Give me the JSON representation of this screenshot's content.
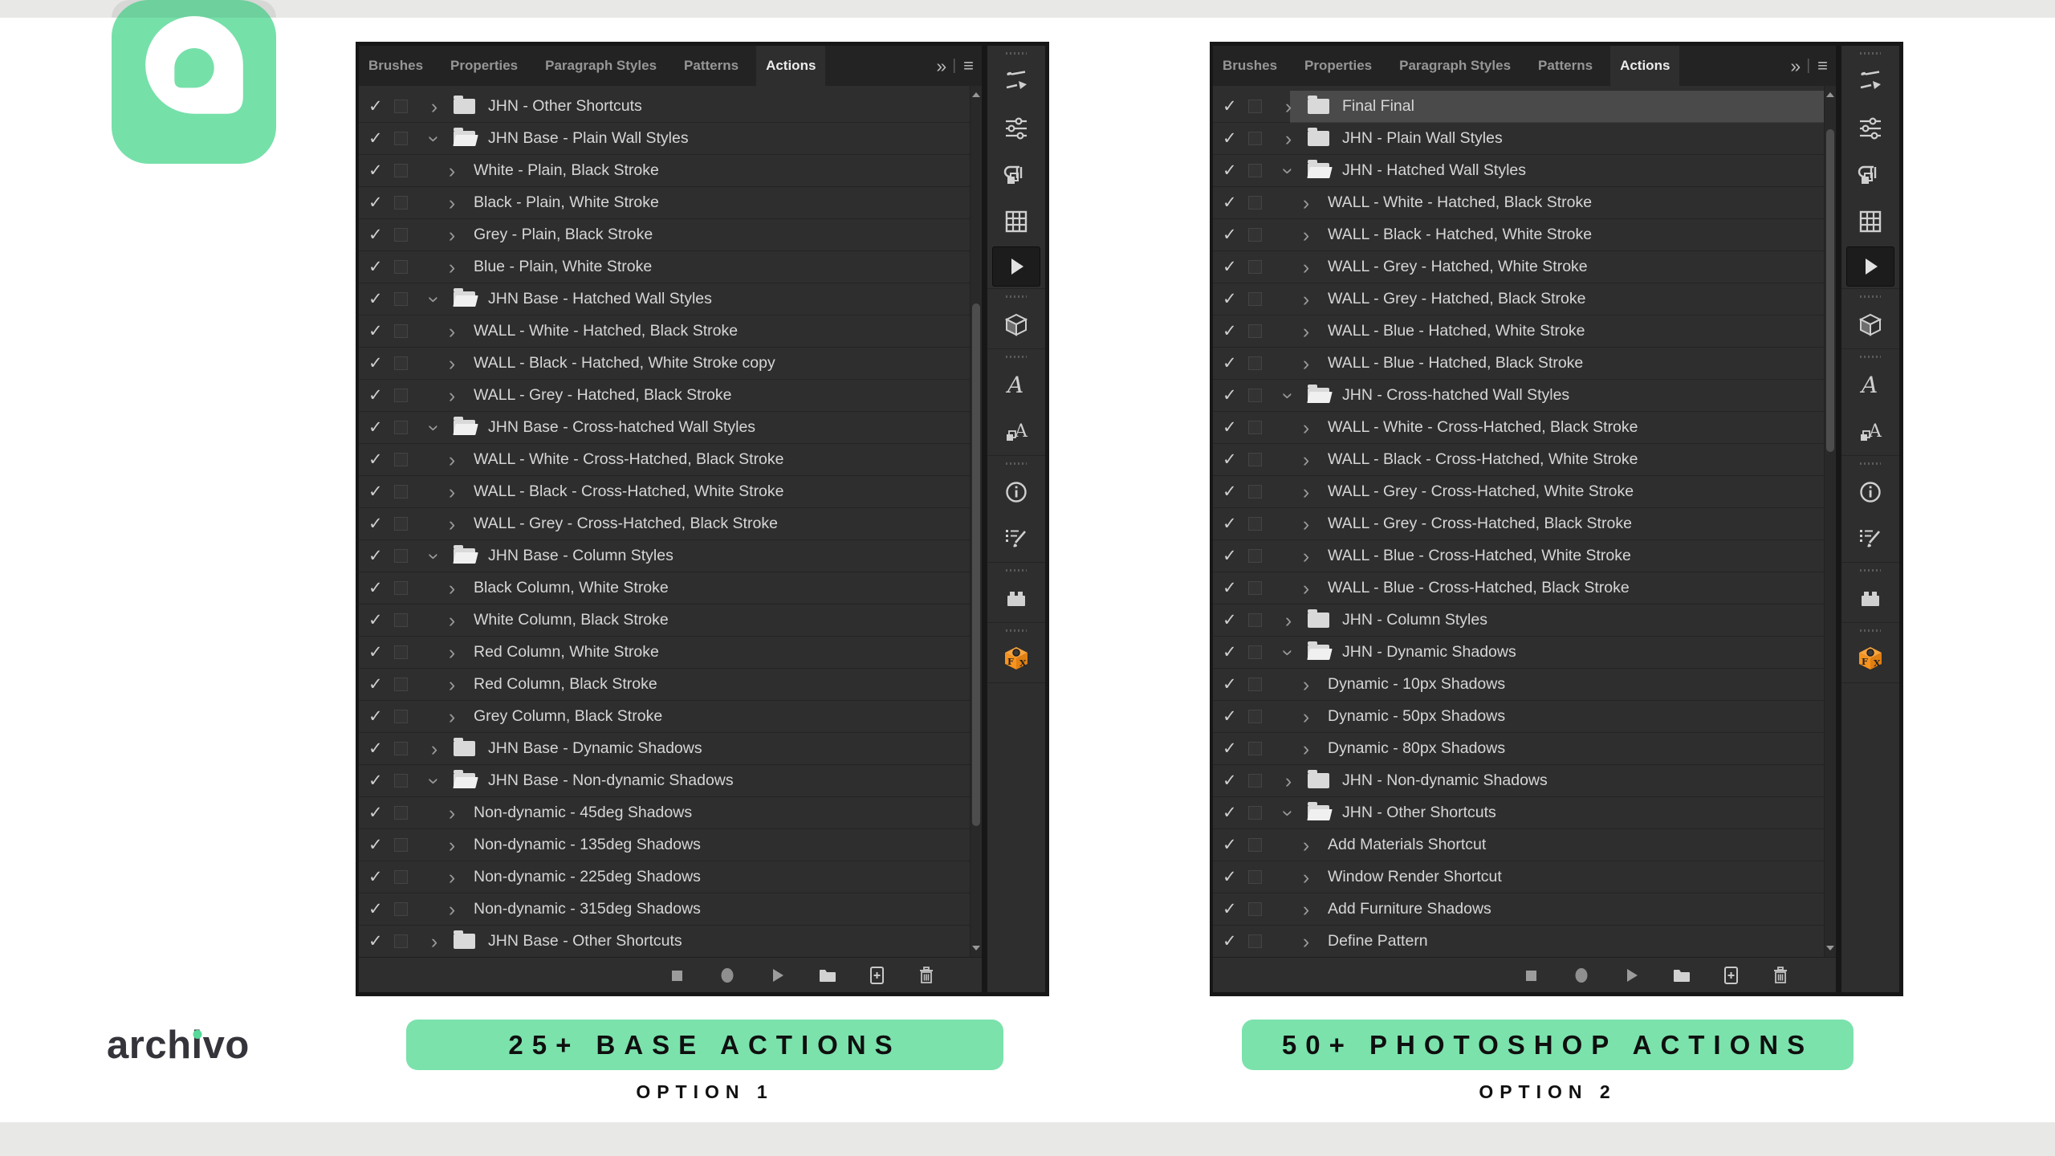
{
  "brand": {
    "wordmark_pre": "arch",
    "wordmark_i": "i",
    "wordmark_post": "vo",
    "accent_green": "#76e0a9"
  },
  "options": {
    "left": {
      "badge": "25+ BASE ACTIONS",
      "caption": "OPTION 1"
    },
    "right": {
      "badge": "50+ PHOTOSHOP ACTIONS",
      "caption": "OPTION 2"
    }
  },
  "tabs": {
    "items": [
      {
        "label": "Brushes"
      },
      {
        "label": "Properties"
      },
      {
        "label": "Paragraph Styles"
      },
      {
        "label": "Patterns"
      },
      {
        "label": "Actions",
        "active": true
      }
    ],
    "active": "Actions"
  },
  "icons": {
    "panel_overflow": "»",
    "panel_menu": "≡",
    "row_check": "✓",
    "row_chevron": "›",
    "toolbar": [
      "brushes-icon",
      "properties-sliders-icon",
      "paragraph-styles-icon",
      "patterns-icon",
      "actions-play-icon",
      "3d-cube-icon",
      "character-a-icon",
      "character-styles-icon",
      "info-icon",
      "tool-presets-icon",
      "plugin-brick-icon",
      "fx-plugin-cube-icon"
    ],
    "toolbar_active": "actions-play-icon",
    "transport": [
      "stop",
      "record",
      "play",
      "load-set-folder",
      "new-action",
      "delete-trash"
    ],
    "fx_orange": "#f7941e"
  },
  "colors": {
    "panel_bg": "#2e2e2e",
    "header_bg": "#232323",
    "selection": "#4a4a4a",
    "badge_green": "#7be2ac"
  },
  "left_panel": {
    "rows": [
      {
        "type": "set",
        "label": "JHN - Other Shortcuts"
      },
      {
        "type": "set",
        "expanded": true,
        "label": "JHN Base - Plain Wall Styles"
      },
      {
        "type": "act",
        "label": "White - Plain, Black Stroke"
      },
      {
        "type": "act",
        "label": "Black - Plain, White Stroke"
      },
      {
        "type": "act",
        "label": "Grey - Plain, Black Stroke"
      },
      {
        "type": "act",
        "label": "Blue - Plain, White Stroke"
      },
      {
        "type": "set",
        "expanded": true,
        "label": "JHN Base - Hatched Wall Styles"
      },
      {
        "type": "act",
        "label": "WALL - White - Hatched, Black Stroke"
      },
      {
        "type": "act",
        "label": "WALL - Black - Hatched, White Stroke copy"
      },
      {
        "type": "act",
        "label": "WALL - Grey - Hatched, Black Stroke"
      },
      {
        "type": "set",
        "expanded": true,
        "label": "JHN Base - Cross-hatched Wall Styles"
      },
      {
        "type": "act",
        "label": "WALL - White - Cross-Hatched, Black Stroke"
      },
      {
        "type": "act",
        "label": "WALL - Black - Cross-Hatched, White Stroke"
      },
      {
        "type": "act",
        "label": "WALL - Grey - Cross-Hatched, Black Stroke"
      },
      {
        "type": "set",
        "expanded": true,
        "label": "JHN Base - Column Styles"
      },
      {
        "type": "act",
        "label": "Black Column, White Stroke"
      },
      {
        "type": "act",
        "label": "White Column, Black Stroke"
      },
      {
        "type": "act",
        "label": "Red Column, White Stroke"
      },
      {
        "type": "act",
        "label": "Red Column, Black Stroke"
      },
      {
        "type": "act",
        "label": "Grey Column, Black Stroke"
      },
      {
        "type": "set",
        "label": "JHN Base - Dynamic Shadows"
      },
      {
        "type": "set",
        "expanded": true,
        "label": "JHN Base - Non-dynamic Shadows"
      },
      {
        "type": "act",
        "label": "Non-dynamic - 45deg Shadows"
      },
      {
        "type": "act",
        "label": "Non-dynamic - 135deg Shadows"
      },
      {
        "type": "act",
        "label": "Non-dynamic - 225deg Shadows"
      },
      {
        "type": "act",
        "label": "Non-dynamic - 315deg Shadows"
      },
      {
        "type": "set",
        "label": "JHN Base - Other Shortcuts"
      }
    ]
  },
  "right_panel": {
    "rows": [
      {
        "type": "set",
        "selected": true,
        "label": "Final Final"
      },
      {
        "type": "set",
        "label": "JHN - Plain Wall Styles"
      },
      {
        "type": "set",
        "expanded": true,
        "label": "JHN - Hatched Wall Styles"
      },
      {
        "type": "act",
        "label": "WALL - White - Hatched, Black Stroke"
      },
      {
        "type": "act",
        "label": "WALL - Black - Hatched, White Stroke"
      },
      {
        "type": "act",
        "label": "WALL - Grey - Hatched, White Stroke"
      },
      {
        "type": "act",
        "label": "WALL - Grey - Hatched, Black Stroke"
      },
      {
        "type": "act",
        "label": "WALL - Blue - Hatched, White Stroke"
      },
      {
        "type": "act",
        "label": "WALL - Blue - Hatched, Black Stroke"
      },
      {
        "type": "set",
        "expanded": true,
        "label": "JHN - Cross-hatched Wall Styles"
      },
      {
        "type": "act",
        "label": "WALL - White - Cross-Hatched, Black Stroke"
      },
      {
        "type": "act",
        "label": "WALL - Black - Cross-Hatched, White Stroke"
      },
      {
        "type": "act",
        "label": "WALL - Grey - Cross-Hatched, White Stroke"
      },
      {
        "type": "act",
        "label": "WALL - Grey - Cross-Hatched, Black Stroke"
      },
      {
        "type": "act",
        "label": "WALL - Blue - Cross-Hatched, White Stroke"
      },
      {
        "type": "act",
        "label": "WALL - Blue - Cross-Hatched, Black Stroke"
      },
      {
        "type": "set",
        "label": "JHN - Column Styles"
      },
      {
        "type": "set",
        "expanded": true,
        "label": "JHN - Dynamic Shadows"
      },
      {
        "type": "act",
        "label": "Dynamic - 10px Shadows"
      },
      {
        "type": "act",
        "label": "Dynamic - 50px Shadows"
      },
      {
        "type": "act",
        "label": "Dynamic - 80px Shadows"
      },
      {
        "type": "set",
        "label": "JHN - Non-dynamic Shadows"
      },
      {
        "type": "set",
        "expanded": true,
        "label": "JHN - Other Shortcuts"
      },
      {
        "type": "act",
        "label": "Add Materials Shortcut"
      },
      {
        "type": "act",
        "label": "Window Render Shortcut"
      },
      {
        "type": "act",
        "label": "Add Furniture Shadows"
      },
      {
        "type": "act",
        "label": "Define Pattern"
      }
    ]
  }
}
